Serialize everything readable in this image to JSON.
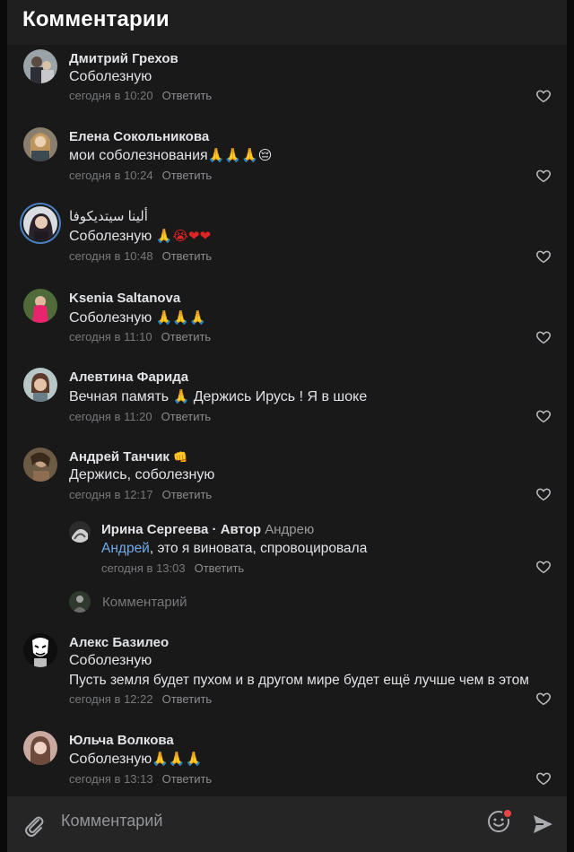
{
  "header": {
    "title": "Комментарии"
  },
  "reply_label": "Ответить",
  "comments": [
    {
      "author": "Дмитрий Грехов",
      "text": "Соболезную",
      "emoji": "",
      "time": "сегодня в 10:20"
    },
    {
      "author": "Елена Сокольникова",
      "text": "мои соболезнования",
      "emoji": "🙏🙏🙏😔",
      "time": "сегодня в 10:24"
    },
    {
      "author": "ألينا سيتديكوفا",
      "text": "Соболезную ",
      "emoji": "🙏😭❤❤",
      "time": "сегодня в 10:48"
    },
    {
      "author": "Ksenia Saltanova",
      "text": "Соболезную ",
      "emoji": "🙏🙏🙏",
      "time": "сегодня в 11:10"
    },
    {
      "author": "Алевтина Фарида",
      "text": "Вечная память ",
      "emoji": "🙏",
      "text_after": " Держись Ирусь ! Я в шоке",
      "time": "сегодня в 11:20"
    },
    {
      "author": "Андрей Танчик",
      "author_emoji": "👊",
      "text": "Держись, соболезную",
      "time": "сегодня в 12:17"
    }
  ],
  "nested_reply": {
    "author": "Ирина Сергеева",
    "author_tag": " · Автор",
    "reply_to": "Андрею",
    "mention": "Андрей",
    "text": ", это я виновата, спровоцировала",
    "time": "сегодня в 13:03"
  },
  "reply_input_placeholder": "Комментарий",
  "comments2": [
    {
      "author": "Алекс Базилео",
      "text": "Соболезную",
      "text2": "Пусть земля будет пухом и в другом мире будет ещё лучше чем в этом",
      "time": "сегодня в 12:22"
    },
    {
      "author": "Юльча Волкова",
      "text": "Соболезную",
      "emoji": "🙏🙏🙏",
      "time": "сегодня в 13:13"
    }
  ],
  "footer": {
    "placeholder": "Комментарий"
  },
  "icons": {
    "attach": "paperclip-icon",
    "emoji": "smile-icon",
    "send": "send-icon",
    "like": "heart-outline-icon"
  },
  "colors": {
    "background": "#19191a",
    "header": "#1f1f20",
    "link": "#71aaeb",
    "muted": "#76787a",
    "notification": "#e64646"
  }
}
